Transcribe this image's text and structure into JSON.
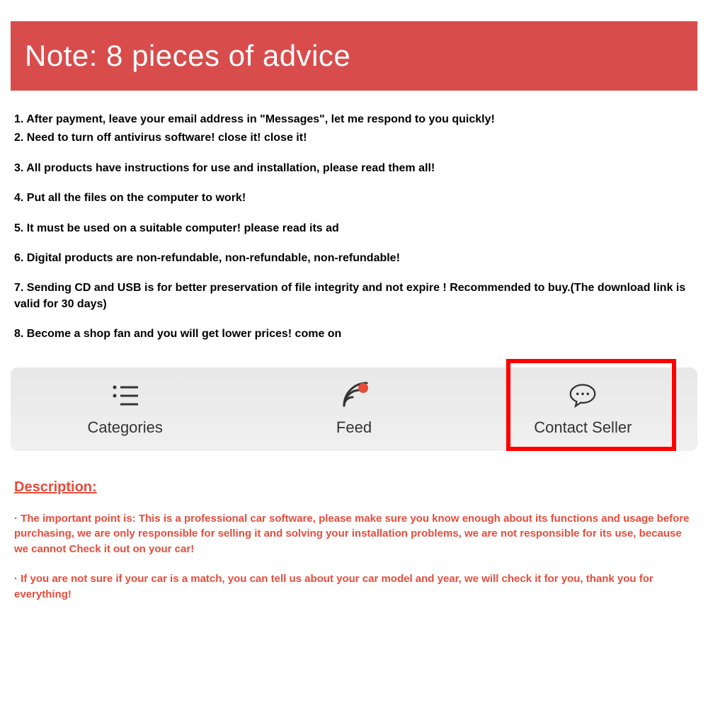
{
  "header": {
    "title": "Note: 8 pieces of advice"
  },
  "advice": [
    "1. After payment, leave your email address in \"Messages\", let me respond to you quickly!",
    "2. Need to turn off antivirus software! close it! close it!",
    "3. All products have instructions for use and installation, please read them all!",
    "4. Put all the files on the computer to work!",
    "5. It must be used on a suitable computer! please read its ad",
    "6. Digital products are non-refundable, non-refundable, non-refundable!",
    "7. Sending CD and USB is for better preservation of file integrity and not expire ! Recommended to buy.(The download link is valid for 30 days)",
    "8. Become a shop fan and you will get lower prices! come on"
  ],
  "nav": {
    "categories": "Categories",
    "feed": "Feed",
    "contact": "Contact Seller"
  },
  "description": {
    "title": "Description:",
    "para1": "· The important point is: This is a professional car software, please make sure you know enough about its functions and usage before purchasing, we are only responsible for selling it and solving your installation problems, we are not responsible for its use, because we cannot Check it out on your car!",
    "para2": "· If you are not sure if your car is a match, you can tell us about your car model and year, we will check it for you, thank you for everything!"
  }
}
